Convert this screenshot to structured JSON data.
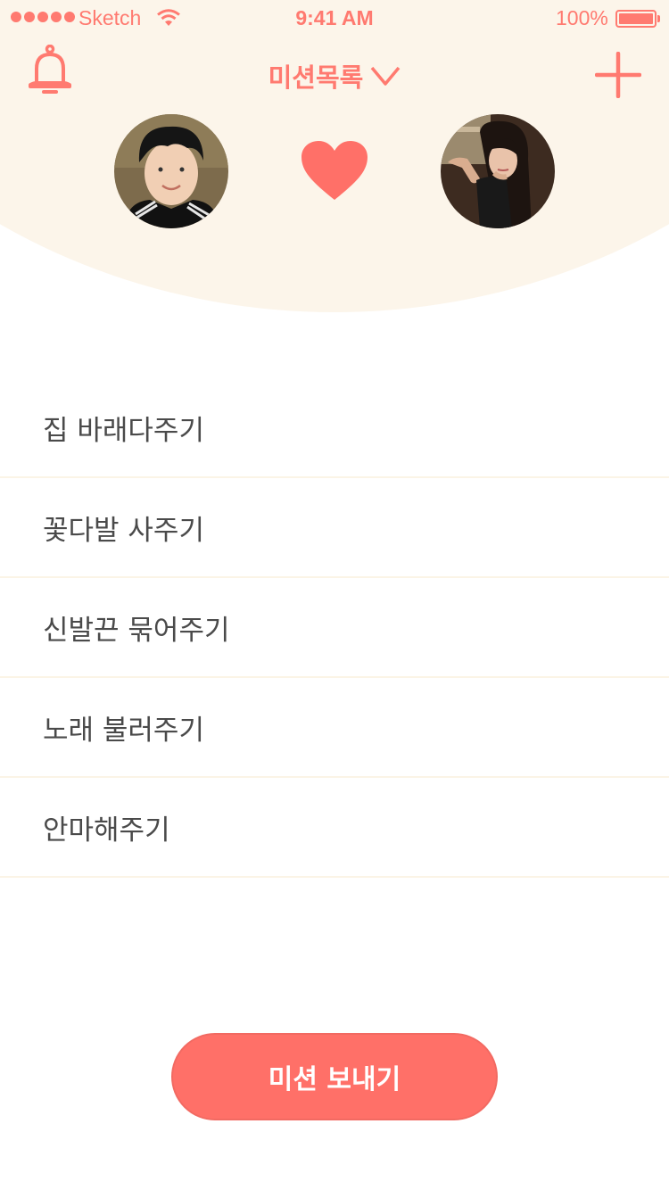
{
  "status_bar": {
    "carrier": "Sketch",
    "time": "9:41 AM",
    "battery": "100%",
    "battery_level": 1.0
  },
  "nav": {
    "left_icon": "bell-icon",
    "title": "미션목록",
    "title_icon": "chevron-down-icon",
    "right_icon": "plus-icon"
  },
  "couple": {
    "left_avatar": "avatar-boy",
    "center_icon": "heart-icon",
    "right_avatar": "avatar-girl"
  },
  "missions": [
    {
      "label": "집 바래다주기"
    },
    {
      "label": "꽃다발 사주기"
    },
    {
      "label": "신발끈 묶어주기"
    },
    {
      "label": "노래 불러주기"
    },
    {
      "label": "안마해주기"
    }
  ],
  "send_button": {
    "label": "미션 보내기"
  },
  "colors": {
    "accent": "#ff7068",
    "header_bg": "#fcf5ea",
    "text": "#4a4a4a",
    "divider": "#fbf4e6"
  }
}
